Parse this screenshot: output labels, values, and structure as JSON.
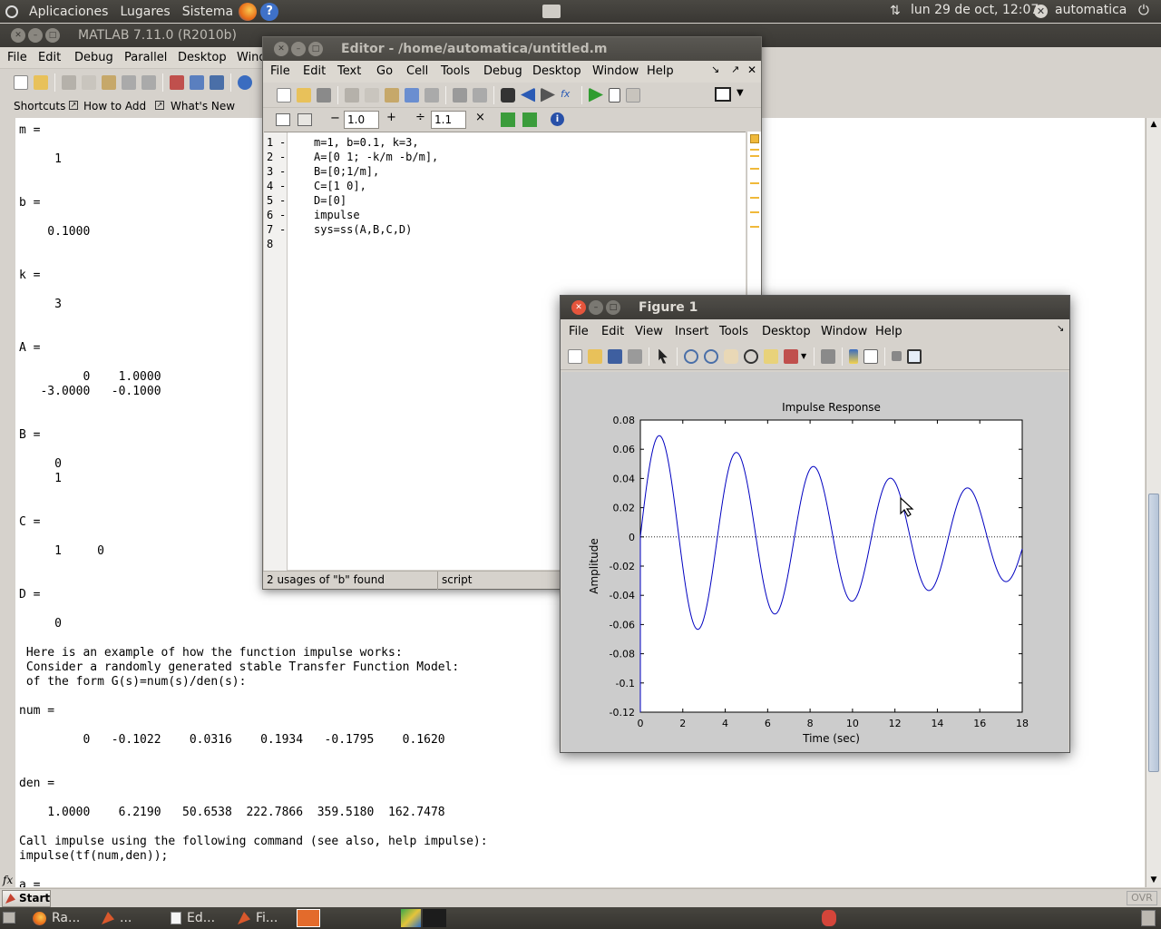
{
  "top_panel": {
    "menus": [
      "Aplicaciones",
      "Lugares",
      "Sistema"
    ],
    "datetime": "lun 29 de oct, 12:07",
    "user": "automatica"
  },
  "matlab": {
    "title": "MATLAB  7.11.0 (R2010b)",
    "menus": [
      "File",
      "Edit",
      "Debug",
      "Parallel",
      "Desktop",
      "Windo"
    ],
    "shortcuts": [
      "Shortcuts",
      "How to Add",
      "What's New"
    ],
    "fx_label": "fx",
    "start_label": "Start",
    "ovr_label": "OVR",
    "command_lines": [
      {
        "y": 136,
        "t": "m ="
      },
      {
        "y": 168,
        "t": "     1"
      },
      {
        "y": 216,
        "t": "b ="
      },
      {
        "y": 248,
        "t": "    0.1000"
      },
      {
        "y": 296,
        "t": "k ="
      },
      {
        "y": 328,
        "t": "     3"
      },
      {
        "y": 376,
        "t": "A ="
      },
      {
        "y": 408,
        "t": "         0    1.0000"
      },
      {
        "y": 424,
        "t": "   -3.0000   -0.1000"
      },
      {
        "y": 472,
        "t": "B ="
      },
      {
        "y": 504,
        "t": "     0"
      },
      {
        "y": 520,
        "t": "     1"
      },
      {
        "y": 568,
        "t": "C ="
      },
      {
        "y": 600,
        "t": "     1     0"
      },
      {
        "y": 648,
        "t": "D ="
      },
      {
        "y": 680,
        "t": "     0"
      },
      {
        "y": 712,
        "t": " Here is an example of how the function impulse works:"
      },
      {
        "y": 728,
        "t": " Consider a randomly generated stable Transfer Function Model:"
      },
      {
        "y": 744,
        "t": " of the form G(s)=num(s)/den(s):"
      },
      {
        "y": 776,
        "t": "num ="
      },
      {
        "y": 808,
        "t": "         0   -0.1022    0.0316    0.1934   -0.1795    0.1620"
      },
      {
        "y": 856,
        "t": "den ="
      },
      {
        "y": 888,
        "t": "    1.0000    6.2190   50.6538  222.7866  359.5180  162.7478"
      },
      {
        "y": 920,
        "t": "Call impulse using the following command (see also, help impulse):"
      },
      {
        "y": 936,
        "t": "impulse(tf(num,den));"
      },
      {
        "y": 968,
        "t": "a ="
      }
    ]
  },
  "editor": {
    "title": "Editor - /home/automatica/untitled.m",
    "menus": [
      "File",
      "Edit",
      "Text",
      "Go",
      "Cell",
      "Tools",
      "Debug",
      "Desktop",
      "Window",
      "Help"
    ],
    "cell_val1": "1.0",
    "cell_val2": "1.1",
    "lines": [
      {
        "n": "1",
        "code": "m=1, b=0.1, k=3,"
      },
      {
        "n": "2",
        "code": "A=[0 1; -k/m -b/m],"
      },
      {
        "n": "3",
        "code": "B=[0;1/m],"
      },
      {
        "n": "4",
        "code": "C=[1 0],"
      },
      {
        "n": "5",
        "code": "D=[0]"
      },
      {
        "n": "6",
        "code": "impulse"
      },
      {
        "n": "7",
        "code": "sys=ss(A,B,C,D)"
      },
      {
        "n": "8",
        "code": ""
      }
    ],
    "status_left": "2 usages of \"b\" found",
    "status_right": "script"
  },
  "figure": {
    "title": "Figure 1",
    "menus": [
      "File",
      "Edit",
      "View",
      "Insert",
      "Tools",
      "Desktop",
      "Window",
      "Help"
    ]
  },
  "chart_data": {
    "type": "line",
    "title": "Impulse Response",
    "xlabel": "Time (sec)",
    "ylabel": "Amplitude",
    "xlim": [
      0,
      18
    ],
    "ylim": [
      -0.12,
      0.08
    ],
    "xticks": [
      0,
      2,
      4,
      6,
      8,
      10,
      12,
      14,
      16,
      18
    ],
    "yticks": [
      0.08,
      0.06,
      0.04,
      0.02,
      0,
      -0.02,
      -0.04,
      -0.06,
      -0.08,
      -0.1,
      -0.12
    ],
    "ytick_labels": [
      "0.08",
      "0.06",
      "0.04",
      "0.02",
      "0",
      "-0.02",
      "-0.04",
      "-0.06",
      "-0.08",
      "-0.1",
      "-0.12"
    ],
    "series": [
      {
        "model": "damped oscillation",
        "omega": 1.7306,
        "zeta": 0.0289,
        "amplitude": 0.0725,
        "color": "#0000c0"
      }
    ],
    "zero_line": true,
    "grid": false
  },
  "taskbar": {
    "items": [
      "Ra...",
      "...",
      "Ed...",
      "Fi..."
    ]
  }
}
